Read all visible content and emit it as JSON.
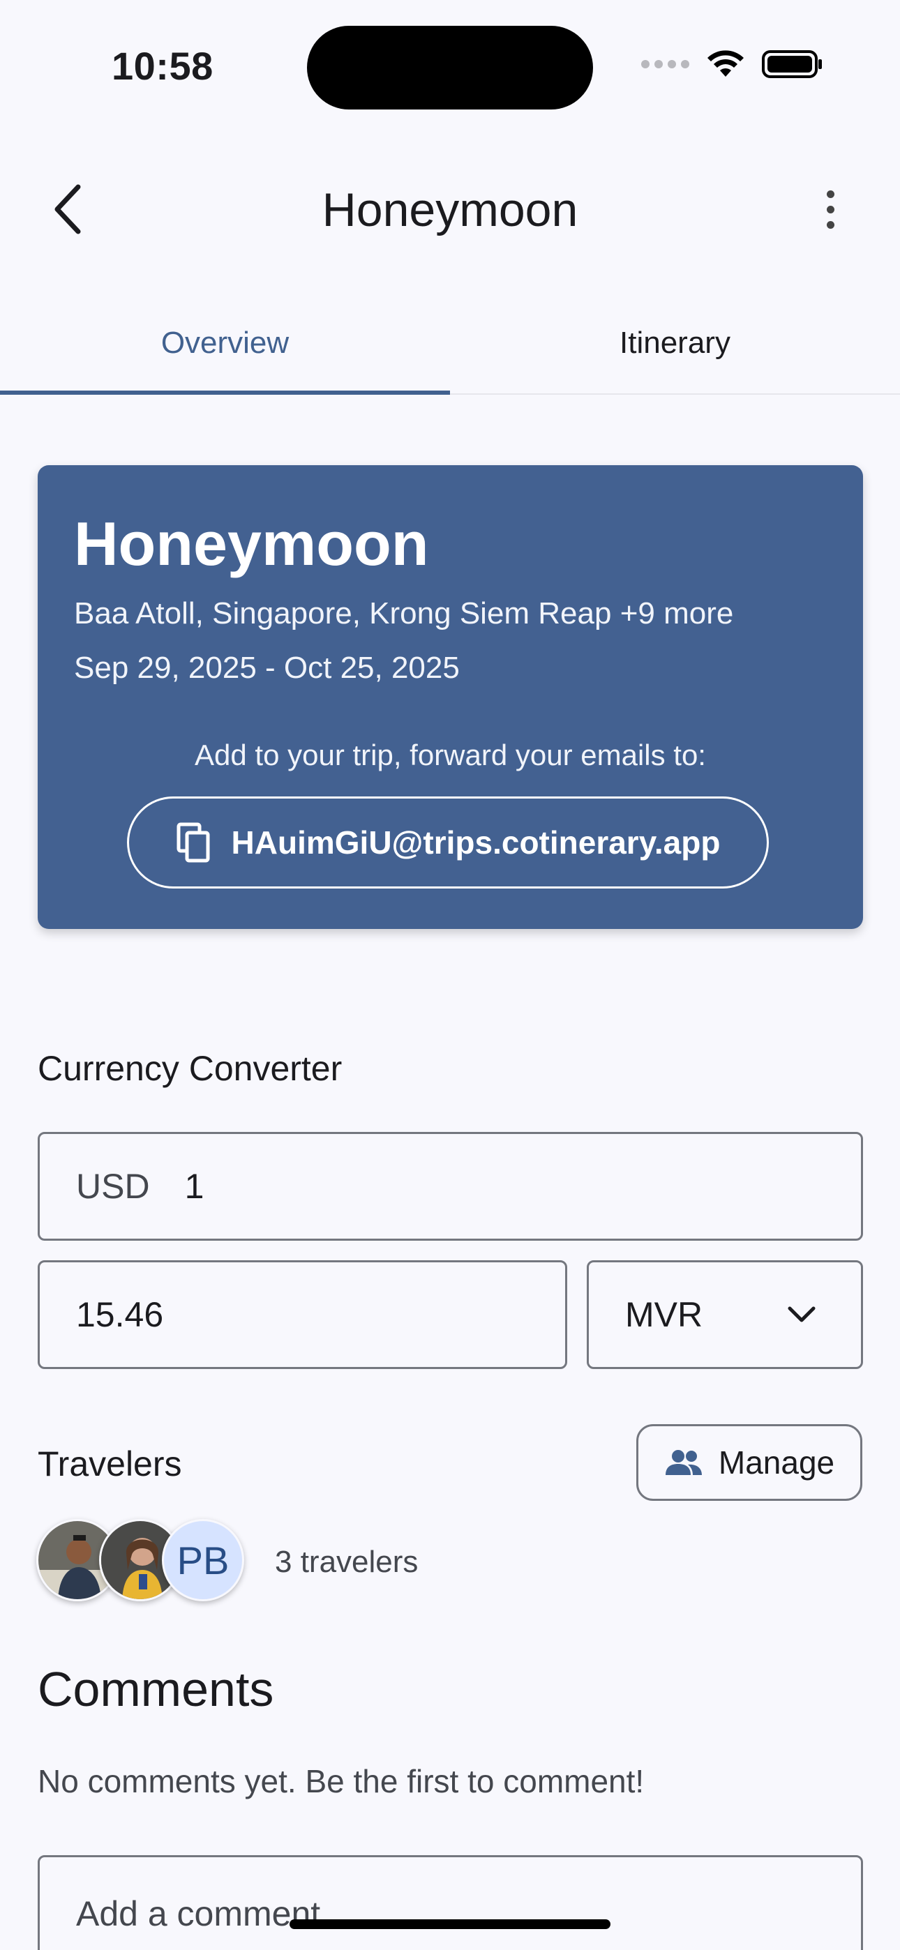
{
  "status_bar": {
    "time": "10:58"
  },
  "app_bar": {
    "title": "Honeymoon",
    "back_icon": "chevron-left-icon",
    "more_icon": "more-vertical-icon"
  },
  "tabs": [
    {
      "label": "Overview",
      "active": true
    },
    {
      "label": "Itinerary",
      "active": false
    }
  ],
  "trip_card": {
    "title": "Honeymoon",
    "destinations": "Baa Atoll, Singapore, Krong Siem Reap +9 more",
    "dates": "Sep 29, 2025 - Oct 25, 2025",
    "forward_hint": "Add to your trip, forward your emails to:",
    "email": "HAuimGiU@trips.cotinerary.app",
    "card_color": "#436191"
  },
  "currency_converter": {
    "label": "Currency Converter",
    "from_currency": "USD",
    "from_amount": "1",
    "to_amount": "15.46",
    "to_currency": "MVR"
  },
  "travelers": {
    "label": "Travelers",
    "manage_label": "Manage",
    "initials": "PB",
    "count_text": "3 travelers"
  },
  "comments": {
    "title": "Comments",
    "empty_text": "No comments yet. Be the first to comment!",
    "input_placeholder": "Add a comment"
  },
  "colors": {
    "accent": "#41618f"
  }
}
